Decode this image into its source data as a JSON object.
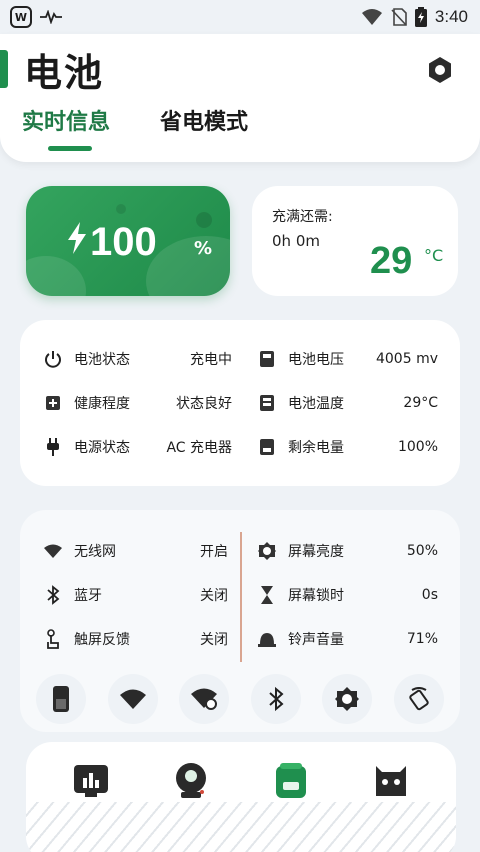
{
  "status_bar": {
    "time": "3:40"
  },
  "header": {
    "title": "电池",
    "tabs": [
      {
        "label": "实时信息",
        "active": true
      },
      {
        "label": "省电模式",
        "active": false
      }
    ]
  },
  "battery": {
    "percent": "100",
    "unit": "%"
  },
  "charge": {
    "label": "充满还需:",
    "time": "0h 0m",
    "temperature": "29",
    "temperature_unit": "°C"
  },
  "battery_info": {
    "left": [
      {
        "label": "电池状态",
        "value": "充电中",
        "icon": "power-icon"
      },
      {
        "label": "健康程度",
        "value": "状态良好",
        "icon": "health-icon"
      },
      {
        "label": "电源状态",
        "value": "AC 充电器",
        "icon": "plug-icon"
      }
    ],
    "right": [
      {
        "label": "电池电压",
        "value": "4005 mv",
        "icon": "voltage-icon"
      },
      {
        "label": "电池温度",
        "value": "29°C",
        "icon": "temperature-icon"
      },
      {
        "label": "剩余电量",
        "value": "100%",
        "icon": "capacity-icon"
      }
    ]
  },
  "system_info": {
    "left": [
      {
        "label": "无线网",
        "value": "开启",
        "icon": "wifi-icon"
      },
      {
        "label": "蓝牙",
        "value": "关闭",
        "icon": "bluetooth-icon"
      },
      {
        "label": "触屏反馈",
        "value": "关闭",
        "icon": "touch-icon"
      }
    ],
    "right": [
      {
        "label": "屏幕亮度",
        "value": "50%",
        "icon": "brightness-icon"
      },
      {
        "label": "屏幕锁时",
        "value": "0s",
        "icon": "hourglass-icon"
      },
      {
        "label": "铃声音量",
        "value": "71%",
        "icon": "bell-icon"
      }
    ]
  },
  "quick_toggles": [
    "battery-toggle-icon",
    "wifi-toggle-icon",
    "wifi-settings-icon",
    "bluetooth-toggle-icon",
    "brightness-toggle-icon",
    "rotate-toggle-icon"
  ],
  "bottom_nav": [
    "stats-icon",
    "monitor-icon",
    "battery-app-icon",
    "android-icon"
  ],
  "colors": {
    "accent": "#1f8f4e",
    "background": "#eef2f6",
    "card": "#ffffff"
  }
}
